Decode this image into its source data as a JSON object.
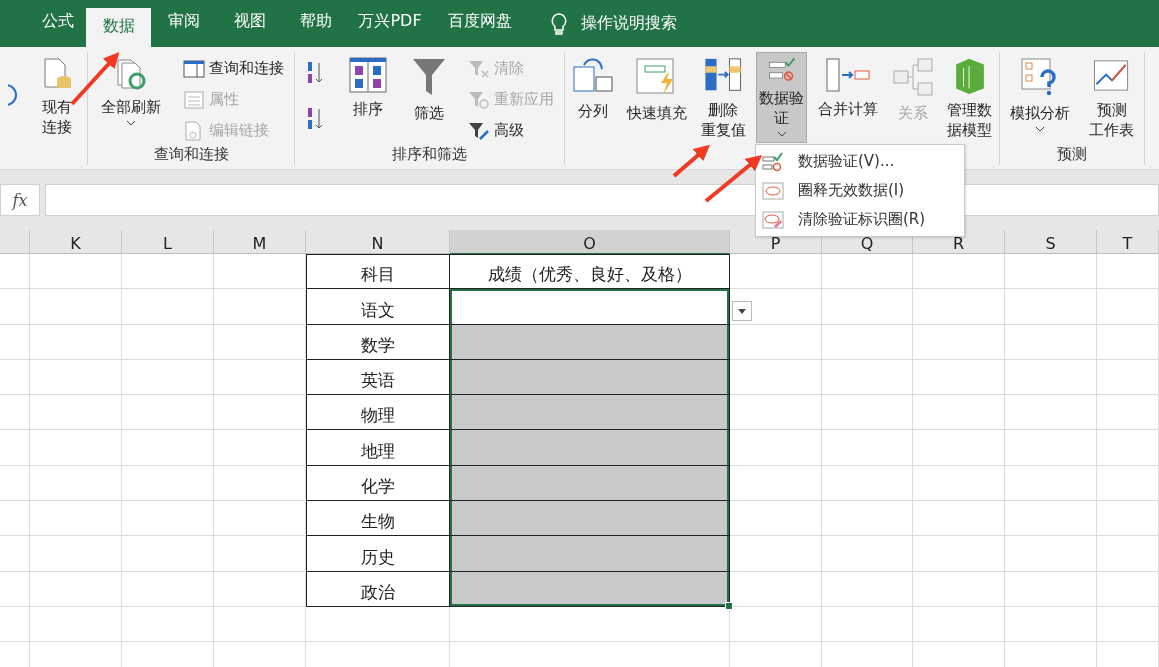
{
  "ribbon_tabs": [
    {
      "label": "公式",
      "selected": false
    },
    {
      "label": "数据",
      "selected": true
    },
    {
      "label": "审阅",
      "selected": false
    },
    {
      "label": "视图",
      "selected": false
    },
    {
      "label": "帮助",
      "selected": false
    },
    {
      "label": "万兴PDF",
      "selected": false
    },
    {
      "label": "百度网盘",
      "selected": false
    }
  ],
  "tell_me": {
    "label": "操作说明搜索"
  },
  "ribbon_groups": [
    {
      "items": [
        {
          "kind": "large",
          "lines": [
            "现有",
            "连接"
          ],
          "disabled": false,
          "pressed": false,
          "caret": false
        }
      ]
    },
    {
      "label": "查询和连接",
      "items": [
        {
          "kind": "large",
          "lines": [
            "全部刷新"
          ],
          "disabled": false,
          "pressed": false,
          "caret": true
        },
        {
          "kind": "stack",
          "entries": [
            {
              "label": "查询和连接",
              "disabled": false
            },
            {
              "label": "属性",
              "disabled": true
            },
            {
              "label": "编辑链接",
              "disabled": true
            }
          ]
        }
      ]
    },
    {
      "label": "排序和筛选",
      "items": [
        {
          "kind": "sortpair"
        },
        {
          "kind": "large",
          "lines": [
            "排序"
          ],
          "disabled": false,
          "pressed": false,
          "caret": false
        },
        {
          "kind": "large",
          "lines": [
            "筛选"
          ],
          "disabled": false,
          "pressed": false,
          "caret": false
        },
        {
          "kind": "stack",
          "entries": [
            {
              "label": "清除",
              "disabled": true
            },
            {
              "label": "重新应用",
              "disabled": true
            },
            {
              "label": "高级",
              "disabled": false
            }
          ]
        }
      ]
    },
    {
      "items": [
        {
          "kind": "large",
          "lines": [
            "分列"
          ],
          "disabled": false,
          "pressed": false,
          "caret": false
        },
        {
          "kind": "large",
          "lines": [
            "快速填充"
          ],
          "disabled": false,
          "pressed": false,
          "caret": false
        },
        {
          "kind": "large",
          "lines": [
            "删除",
            "重复值"
          ],
          "disabled": false,
          "pressed": false,
          "caret": false
        },
        {
          "kind": "large",
          "lines": [
            "数据验",
            "证"
          ],
          "disabled": false,
          "pressed": true,
          "caret": true
        },
        {
          "kind": "large",
          "lines": [
            "合并计算"
          ],
          "disabled": false,
          "pressed": false,
          "caret": false
        },
        {
          "kind": "large",
          "lines": [
            "关系"
          ],
          "disabled": true,
          "pressed": false,
          "caret": false
        },
        {
          "kind": "large",
          "lines": [
            "管理数",
            "据模型"
          ],
          "disabled": false,
          "pressed": false,
          "caret": false
        }
      ]
    },
    {
      "label": "预测",
      "items": [
        {
          "kind": "large",
          "lines": [
            "模拟分析"
          ],
          "disabled": false,
          "pressed": false,
          "caret": true
        },
        {
          "kind": "large",
          "lines": [
            "预测",
            "工作表"
          ],
          "disabled": false,
          "pressed": false,
          "caret": false
        }
      ]
    }
  ],
  "dropdown_menu": [
    {
      "label": "数据验证(V)...",
      "highlighted": false
    },
    {
      "label": "圈释无效数据(I)",
      "highlighted": false
    },
    {
      "label": "清除验证标识圈(R)",
      "highlighted": false
    }
  ],
  "formula_bar": {
    "fx": "fx"
  },
  "columns": [
    {
      "label": "K",
      "selected": false
    },
    {
      "label": "L",
      "selected": false
    },
    {
      "label": "M",
      "selected": false
    },
    {
      "label": "N",
      "selected": false
    },
    {
      "label": "O",
      "selected": true
    },
    {
      "label": "P",
      "selected": false
    },
    {
      "label": "Q",
      "selected": false
    },
    {
      "label": "R",
      "selected": false
    },
    {
      "label": "S",
      "selected": false
    },
    {
      "label": "T",
      "selected": false
    }
  ],
  "table": {
    "header": [
      "科目",
      "成绩（优秀、良好、及格）"
    ],
    "rows": [
      {
        "subject": "语文",
        "active": true,
        "selected": true
      },
      {
        "subject": "数学",
        "active": false,
        "selected": true
      },
      {
        "subject": "英语",
        "active": false,
        "selected": true
      },
      {
        "subject": "物理",
        "active": false,
        "selected": true
      },
      {
        "subject": "地理",
        "active": false,
        "selected": true
      },
      {
        "subject": "化学",
        "active": false,
        "selected": true
      },
      {
        "subject": "生物",
        "active": false,
        "selected": true
      },
      {
        "subject": "历史",
        "active": false,
        "selected": true
      },
      {
        "subject": "政治",
        "active": false,
        "selected": true
      }
    ]
  }
}
